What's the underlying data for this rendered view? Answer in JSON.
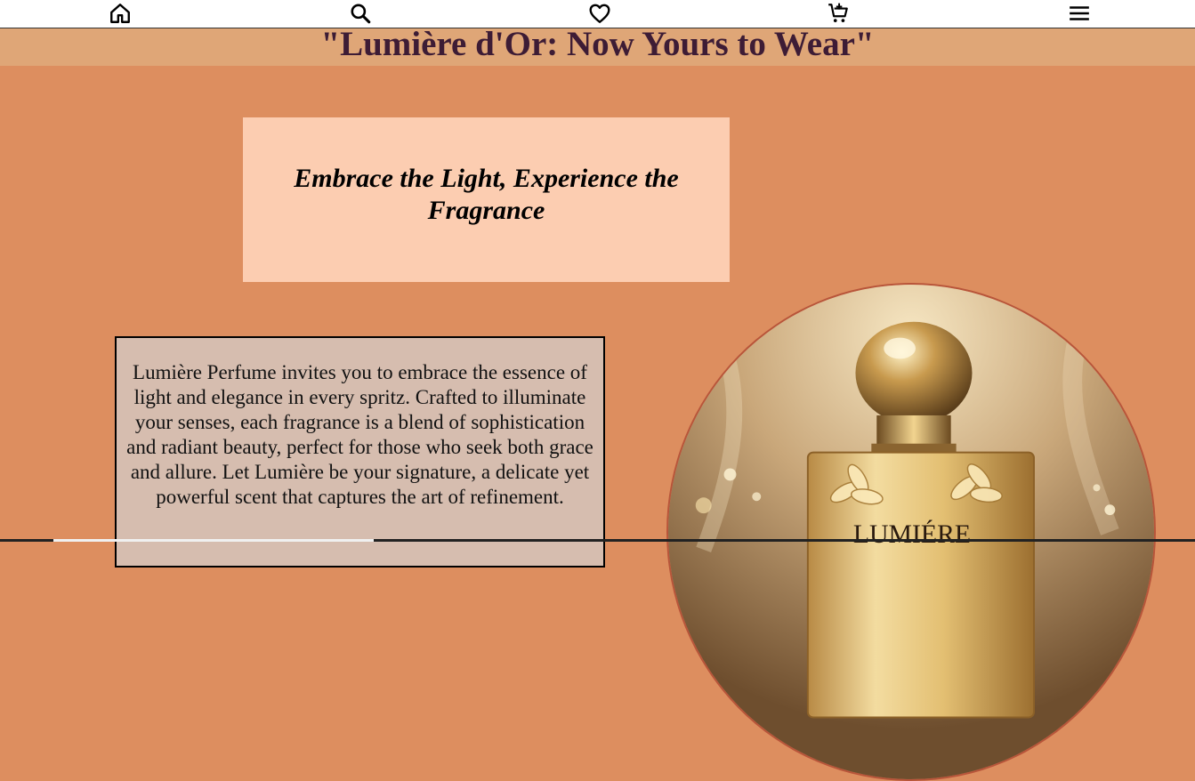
{
  "nav": {
    "items": [
      {
        "icon": "home-icon"
      },
      {
        "icon": "search-icon"
      },
      {
        "icon": "heart-icon"
      },
      {
        "icon": "cart-icon"
      },
      {
        "icon": "menu-icon"
      }
    ]
  },
  "banner": {
    "title": "\"Lumière d'Or: Now Yours to Wear\""
  },
  "hero": {
    "tagline": "Embrace the Light, Experience the Fragrance"
  },
  "about": {
    "text": "Lumière Perfume invites you to embrace the essence of light and elegance in every spritz. Crafted to illuminate your senses, each fragrance is a blend of sophistication and radiant beauty, perfect for those who seek both grace and allure. Let Lumière be your signature, a delicate yet powerful scent that captures the art of refinement."
  },
  "product_image": {
    "label": "LUMIÉRE"
  },
  "colors": {
    "page_bg": "#dd8e5f",
    "banner_bg": "#dfa677",
    "title_color": "#3d1c35",
    "tagline_bg": "#fccdb1",
    "desc_bg": "#d6bdaf"
  }
}
